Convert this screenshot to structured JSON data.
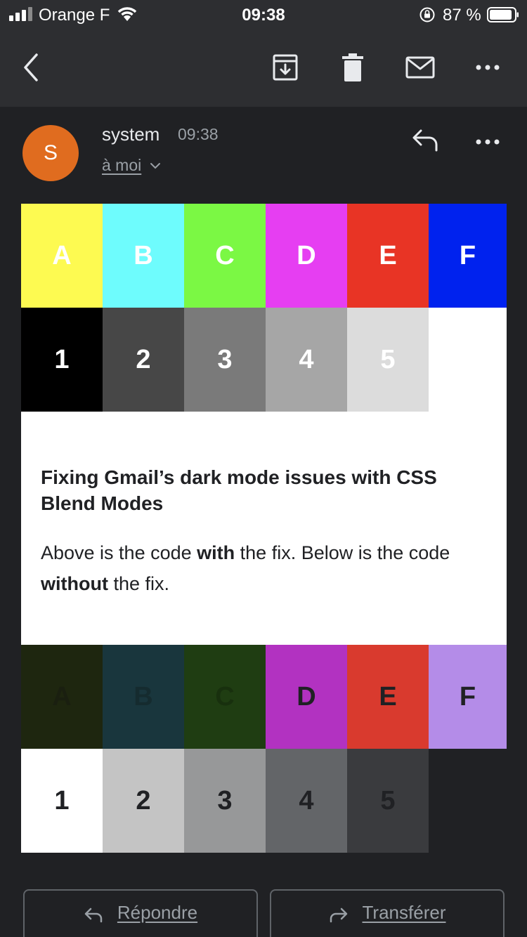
{
  "status_bar": {
    "carrier": "Orange F",
    "time": "09:38",
    "battery_percent": "87 %",
    "icons": [
      "signal-icon",
      "wifi-icon",
      "orientation-lock-icon",
      "battery-icon"
    ]
  },
  "toolbar": {
    "icons": [
      "back-icon",
      "archive-icon",
      "delete-icon",
      "mark-unread-icon",
      "more-icon"
    ]
  },
  "message": {
    "avatar_letter": "S",
    "sender": "system",
    "time": "09:38",
    "recipient": "à moi",
    "avatar_color": "#e06c1f"
  },
  "email_body": {
    "top_letters": [
      {
        "label": "A",
        "bg": "#fdfa51",
        "fg": "#ffffff"
      },
      {
        "label": "B",
        "bg": "#6efcfd",
        "fg": "#ffffff"
      },
      {
        "label": "C",
        "bg": "#7bf844",
        "fg": "#ffffff"
      },
      {
        "label": "D",
        "bg": "#e63ef2",
        "fg": "#ffffff"
      },
      {
        "label": "E",
        "bg": "#e83425",
        "fg": "#ffffff"
      },
      {
        "label": "F",
        "bg": "#0022ee",
        "fg": "#ffffff"
      }
    ],
    "top_numbers": [
      {
        "label": "1",
        "bg": "#000000",
        "fg": "#ffffff"
      },
      {
        "label": "2",
        "bg": "#474747",
        "fg": "#ffffff"
      },
      {
        "label": "3",
        "bg": "#7a7a7a",
        "fg": "#ffffff"
      },
      {
        "label": "4",
        "bg": "#a6a6a6",
        "fg": "#ffffff"
      },
      {
        "label": "5",
        "bg": "#dcdcdc",
        "fg": "#ffffff"
      },
      {
        "label": "",
        "bg": "#ffffff",
        "fg": "#ffffff"
      }
    ],
    "headline": "Fixing Gmail’s dark mode issues with CSS Blend Modes",
    "para_1": "Above is the code ",
    "para_bold_1": "with",
    "para_2": " the fix. Below is the code ",
    "para_bold_2": "without",
    "para_3": " the fix.",
    "bottom_letters": [
      {
        "label": "A",
        "bg": "#1e260f",
        "fg": "#1a1f10"
      },
      {
        "label": "B",
        "bg": "#19363d",
        "fg": "#152b2f"
      },
      {
        "label": "C",
        "bg": "#1f3d12",
        "fg": "#18300e"
      },
      {
        "label": "D",
        "bg": "#b232c1",
        "fg": "#202124"
      },
      {
        "label": "E",
        "bg": "#d93a2e",
        "fg": "#202124"
      },
      {
        "label": "F",
        "bg": "#b48ce8",
        "fg": "#202124"
      }
    ],
    "bottom_numbers": [
      {
        "label": "1",
        "bg": "#ffffff",
        "fg": "#202124"
      },
      {
        "label": "2",
        "bg": "#c4c4c4",
        "fg": "#202124"
      },
      {
        "label": "3",
        "bg": "#979899",
        "fg": "#202124"
      },
      {
        "label": "4",
        "bg": "#636568",
        "fg": "#202124"
      },
      {
        "label": "5",
        "bg": "#3a3b3e",
        "fg": "#202124"
      },
      {
        "label": "",
        "bg": "#202124",
        "fg": "#202124"
      }
    ]
  },
  "actions": {
    "reply": "Répondre",
    "forward": "Transférer"
  }
}
